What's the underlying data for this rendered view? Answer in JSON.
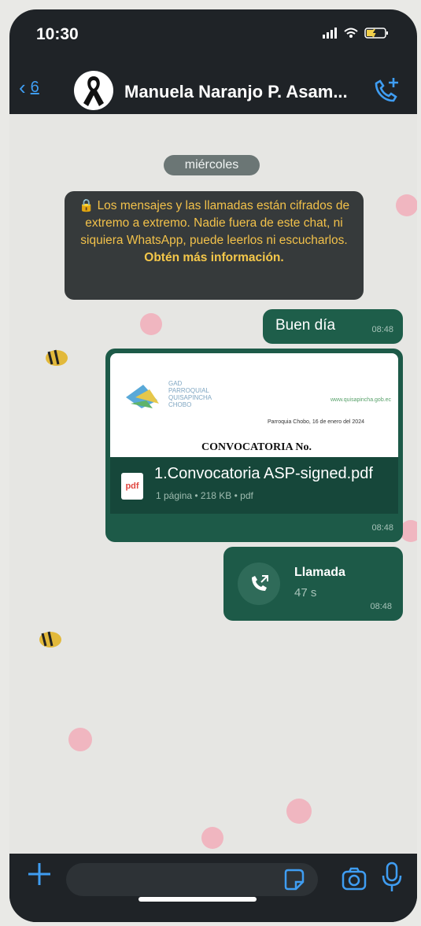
{
  "status_bar": {
    "time": "10:30"
  },
  "header": {
    "back_count": "6",
    "contact_name": "Manuela Naranjo P. Asam...",
    "colors": {
      "accent": "#3f9df2"
    }
  },
  "chat": {
    "date_label": "miércoles",
    "system_message": {
      "lock_icon": "lock-icon",
      "text": "Los mensajes y las llamadas están cifrados de extremo a extremo. Nadie fuera de este chat, ni siquiera WhatsApp, puede leerlos ni escucharlos.",
      "link": "Obtén más información."
    },
    "messages": [
      {
        "type": "text",
        "text": "Buen día",
        "time": "08:48"
      },
      {
        "type": "document",
        "preview": {
          "logo_text": "GAD PARROQUIAL QUISAPINCHA CHOBO",
          "website": "www.quisapincha.gob.ec",
          "date_line": "Parroquia Chobo, 16 de enero del 2024",
          "heading": "CONVOCATORIA No."
        },
        "file_name": "1.Convocatoria ASP-signed.pdf",
        "file_meta": "1 página • 218 KB • pdf",
        "time": "08:48"
      },
      {
        "type": "call",
        "title": "Llamada",
        "duration": "47 s",
        "time": "08:48"
      }
    ]
  },
  "composer": {
    "placeholder": ""
  }
}
